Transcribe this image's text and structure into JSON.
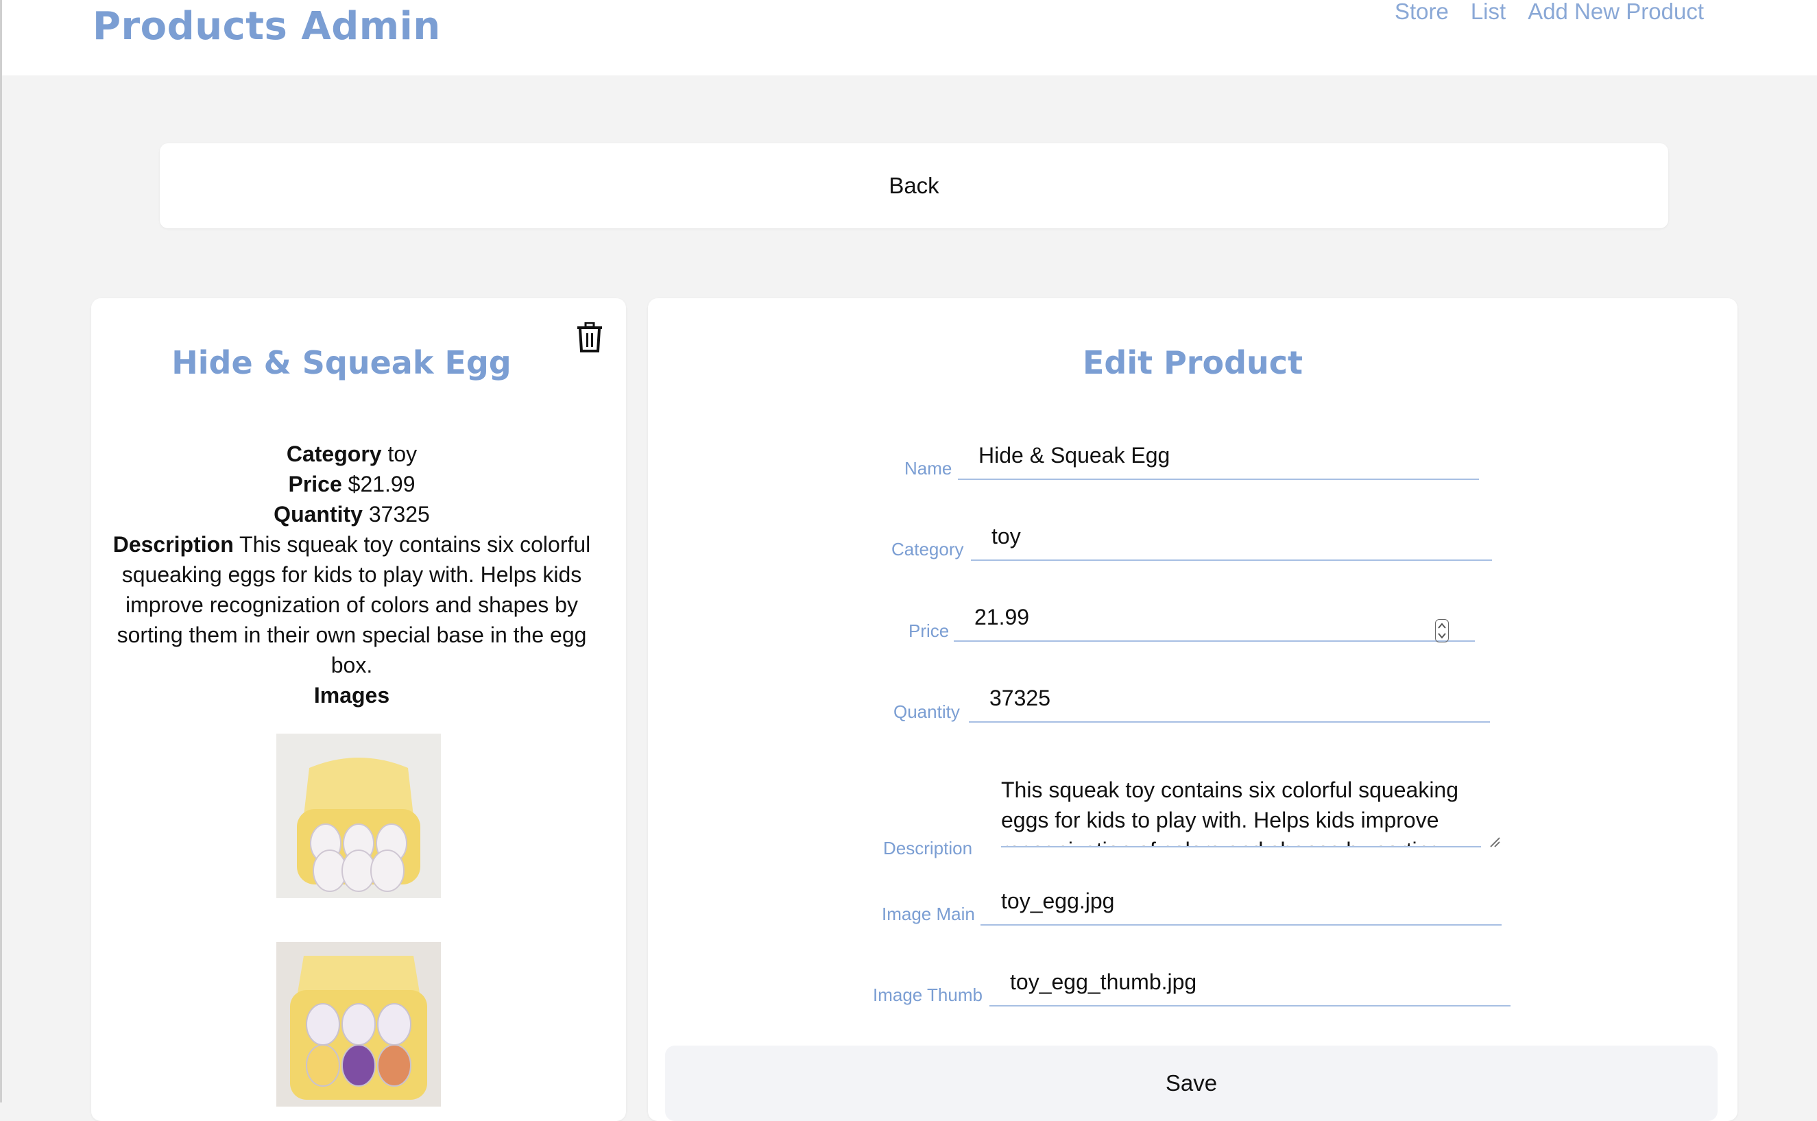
{
  "header": {
    "brand": "Products Admin",
    "nav": [
      "Store",
      "List",
      "Add New Product"
    ]
  },
  "back_label": "Back",
  "product": {
    "title": "Hide & Squeak Egg",
    "category_label": "Category",
    "category": "toy",
    "price_label": "Price",
    "price": "$21.99",
    "quantity_label": "Quantity",
    "quantity": "37325",
    "description_label": "Description",
    "description": "This squeak toy contains six colorful squeaking eggs for kids to play with. Helps kids improve recognization of colors and shapes by sorting them in their own special base in the egg box.",
    "images_label": "Images"
  },
  "edit": {
    "title": "Edit Product",
    "fields": {
      "name": {
        "label": "Name",
        "value": "Hide & Squeak Egg"
      },
      "category": {
        "label": "Category",
        "value": "toy"
      },
      "price": {
        "label": "Price",
        "value": "21.99"
      },
      "quantity": {
        "label": "Quantity",
        "value": "37325"
      },
      "description": {
        "label": "Description",
        "value": "This squeak toy contains six colorful squeaking eggs for kids to play with. Helps kids improve recognization of colors and shapes by sorting them in their own special base in the egg box."
      },
      "image_main": {
        "label": "Image Main",
        "value": "toy_egg.jpg"
      },
      "image_thumb": {
        "label": "Image Thumb",
        "value": "toy_egg_thumb.jpg"
      }
    },
    "save_label": "Save"
  },
  "colors": {
    "accent": "#7b9ed3",
    "nav": "#8aa8d6",
    "underline": "#a7bfe3",
    "page_bg": "#f3f3f3"
  }
}
